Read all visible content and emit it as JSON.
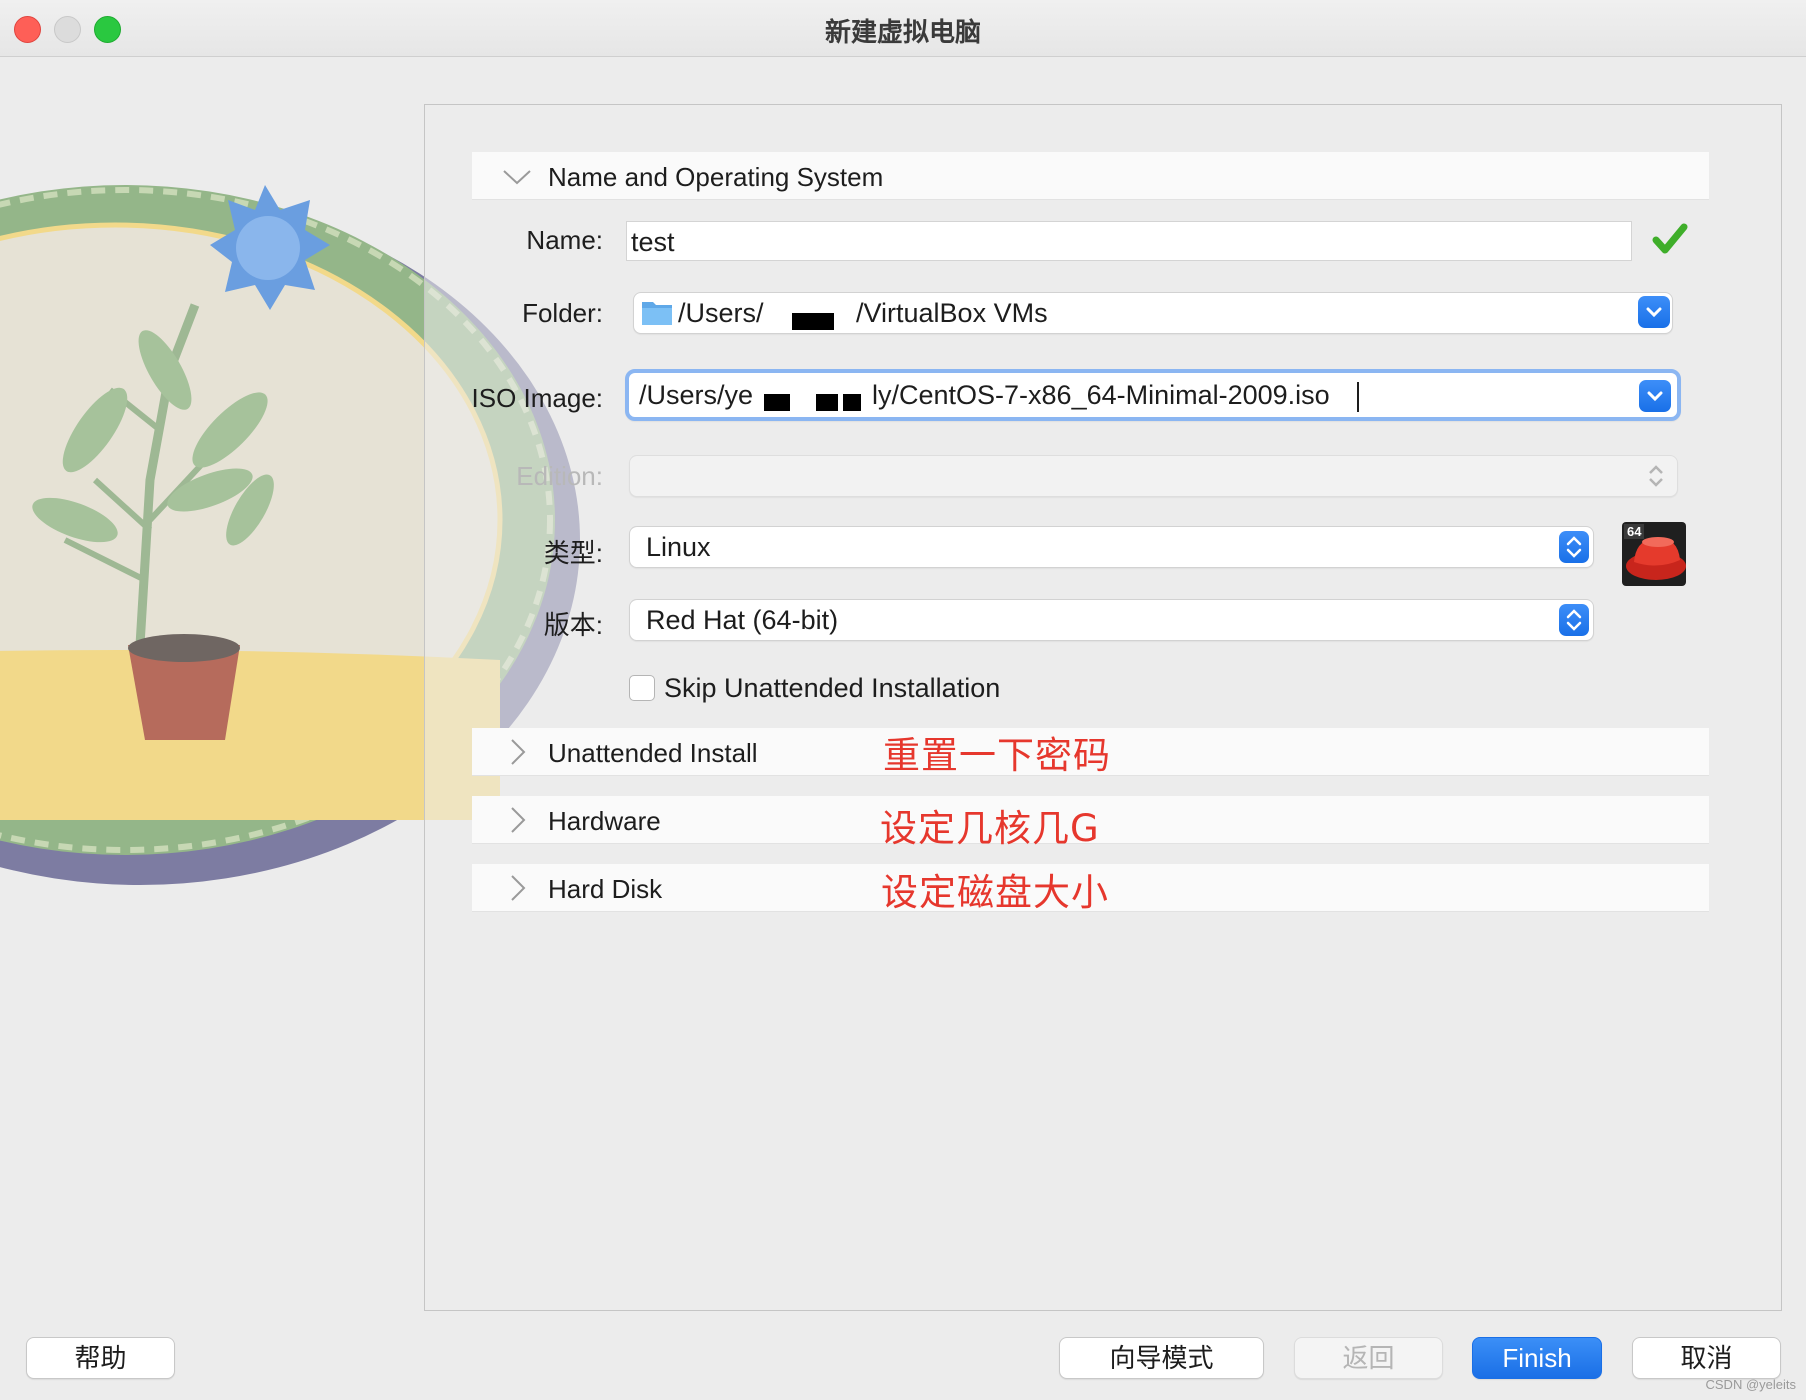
{
  "window": {
    "title": "新建虚拟电脑"
  },
  "sections": {
    "name_os": "Name and Operating System",
    "unattended": "Unattended Install",
    "hardware": "Hardware",
    "hard_disk": "Hard Disk"
  },
  "form": {
    "name_label": "Name:",
    "name_value": "test",
    "folder_label": "Folder:",
    "folder_value_start": "/Users/",
    "folder_value_end": "/VirtualBox VMs",
    "iso_label": "ISO Image:",
    "iso_value_start": "/Users/ye",
    "iso_value_end": "ly/CentOS-7-x86_64-Minimal-2009.iso",
    "edition_label": "Edition:",
    "edition_value": "",
    "type_label": "类型:",
    "type_value": "Linux",
    "version_label": "版本:",
    "version_value": "Red Hat (64-bit)",
    "os_badge": "64",
    "skip_label": "Skip Unattended Installation",
    "skip_checked": false
  },
  "annotations": {
    "unattended_note": "重置一下密码",
    "hardware_note": "设定几核几G",
    "disk_note": "设定磁盘大小"
  },
  "buttons": {
    "help": "帮助",
    "guided": "向导模式",
    "back": "返回",
    "finish": "Finish",
    "cancel": "取消"
  },
  "credit": "CSDN @yeleits",
  "colors": {
    "accent": "#1a6fe6",
    "annotation": "#e6372d",
    "valid_check": "#3fae2a"
  }
}
